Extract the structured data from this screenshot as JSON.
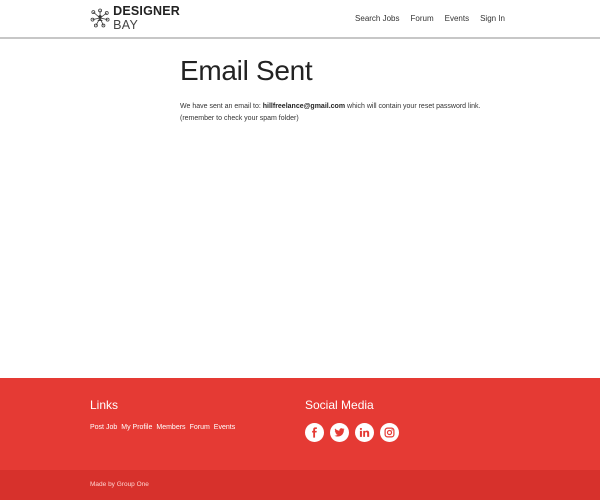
{
  "header": {
    "logo": {
      "line1": "DESIGNER",
      "line2": "BAY",
      "icon": "network-people-icon"
    },
    "nav": [
      {
        "label": "Search Jobs"
      },
      {
        "label": "Forum"
      },
      {
        "label": "Events"
      },
      {
        "label": "Sign In"
      }
    ]
  },
  "main": {
    "title": "Email Sent",
    "message_prefix": "We have sent an email to: ",
    "email": "hillfreelance@gmail.com",
    "message_suffix": " which will contain your reset password link.",
    "note": "(remember to check your spam folder)"
  },
  "footer": {
    "links_heading": "Links",
    "links": [
      {
        "label": "Post Job"
      },
      {
        "label": "My Profile"
      },
      {
        "label": "Members"
      },
      {
        "label": "Forum"
      },
      {
        "label": "Events"
      }
    ],
    "social_heading": "Social Media",
    "social": [
      {
        "icon": "facebook-icon"
      },
      {
        "icon": "twitter-icon"
      },
      {
        "icon": "linkedin-icon"
      },
      {
        "icon": "instagram-icon"
      }
    ],
    "made_by": "Made by Group One"
  },
  "colors": {
    "footer_bg": "#e53a34",
    "footer_bottom_bg": "#d7312c",
    "header_border": "#c7c7c7"
  }
}
